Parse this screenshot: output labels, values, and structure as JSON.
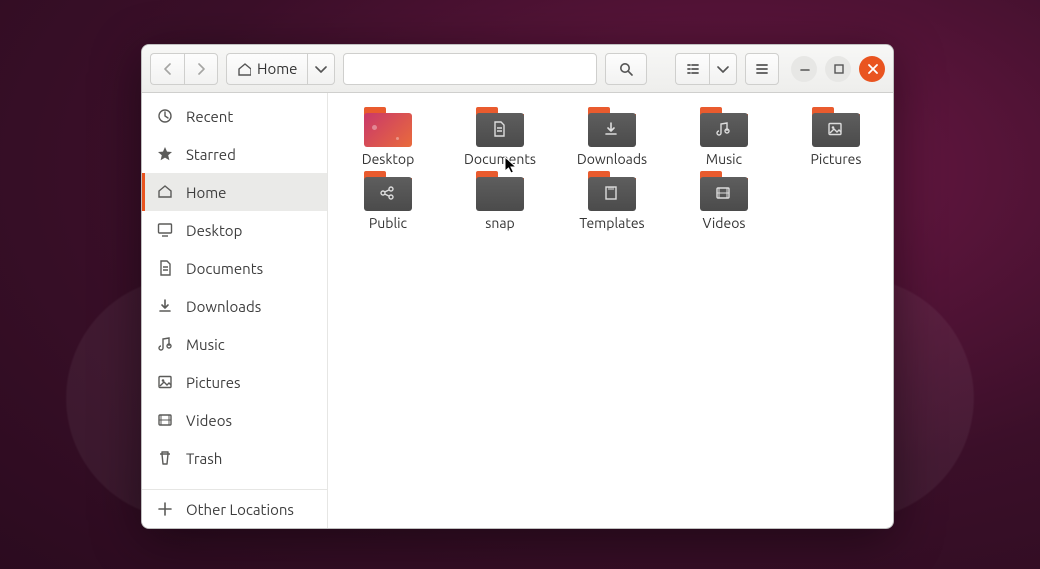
{
  "header": {
    "path_label": "Home"
  },
  "sidebar": {
    "items": [
      {
        "label": "Recent",
        "icon": "clock"
      },
      {
        "label": "Starred",
        "icon": "star"
      },
      {
        "label": "Home",
        "icon": "home",
        "active": true
      },
      {
        "label": "Desktop",
        "icon": "desktop"
      },
      {
        "label": "Documents",
        "icon": "doc"
      },
      {
        "label": "Downloads",
        "icon": "download"
      },
      {
        "label": "Music",
        "icon": "music"
      },
      {
        "label": "Pictures",
        "icon": "picture"
      },
      {
        "label": "Videos",
        "icon": "video"
      },
      {
        "label": "Trash",
        "icon": "trash"
      }
    ],
    "other_label": "Other Locations"
  },
  "folders": [
    {
      "label": "Desktop",
      "icon": "desktop-folder"
    },
    {
      "label": "Documents",
      "icon": "doc"
    },
    {
      "label": "Downloads",
      "icon": "download"
    },
    {
      "label": "Music",
      "icon": "music"
    },
    {
      "label": "Pictures",
      "icon": "picture"
    },
    {
      "label": "Public",
      "icon": "share"
    },
    {
      "label": "snap",
      "icon": "plain"
    },
    {
      "label": "Templates",
      "icon": "template"
    },
    {
      "label": "Videos",
      "icon": "video"
    }
  ]
}
